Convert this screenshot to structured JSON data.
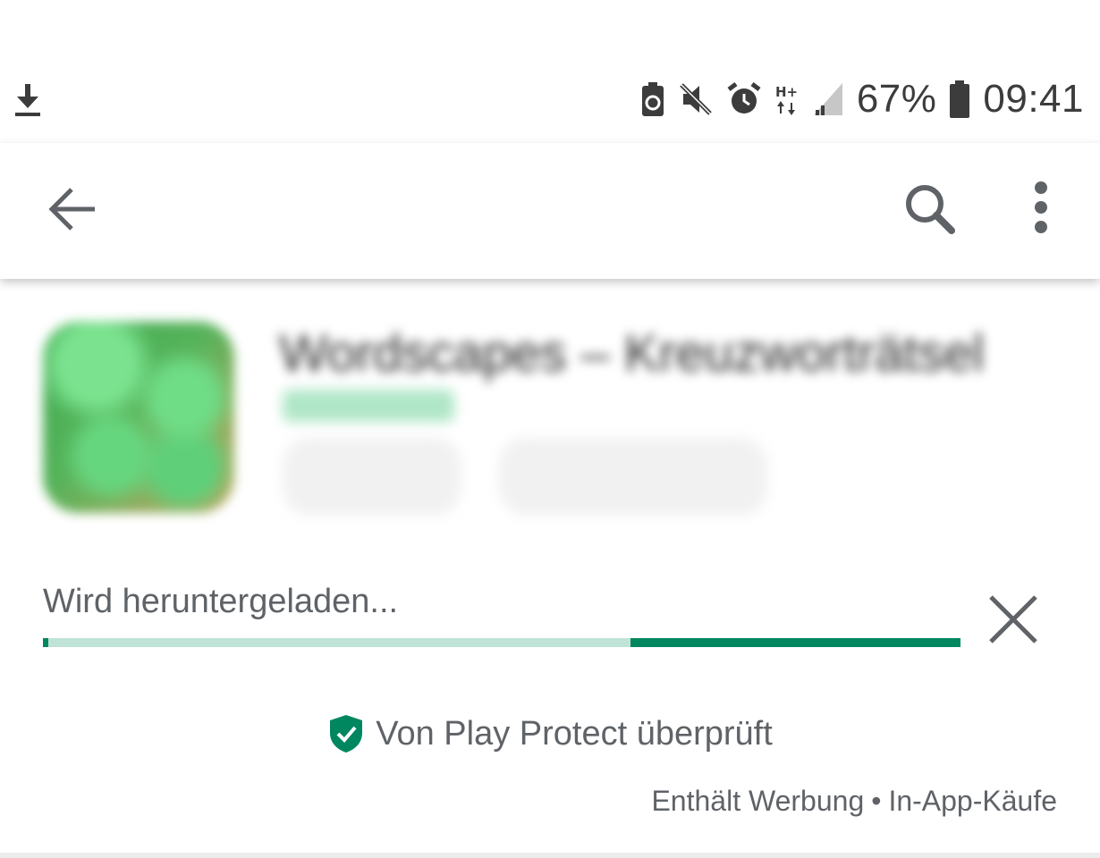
{
  "status_bar": {
    "battery_percent": "67%",
    "time": "09:41",
    "network_type": "H+",
    "icons": [
      "download-icon",
      "battery-saver-icon",
      "mute-icon",
      "alarm-icon",
      "network-type-icon",
      "signal-icon",
      "battery-icon"
    ]
  },
  "app_bar": {
    "icons": [
      "back-arrow-icon",
      "search-icon",
      "more-vert-icon"
    ]
  },
  "app_header": {
    "title": "Wordscapes – Kreuzworträtsel",
    "developer": "",
    "chips": [
      "",
      ""
    ]
  },
  "download": {
    "status": "Wird heruntergeladen...",
    "progress_fraction": 0.36,
    "colors": {
      "track": "#bfe3d6",
      "fill": "#01875f"
    }
  },
  "play_protect": {
    "label": "Von Play Protect überprüft",
    "shield_color": "#01875f"
  },
  "ad_info": {
    "ads": "Enthält Werbung",
    "separator": "•",
    "iap": "In-App-Käufe"
  }
}
